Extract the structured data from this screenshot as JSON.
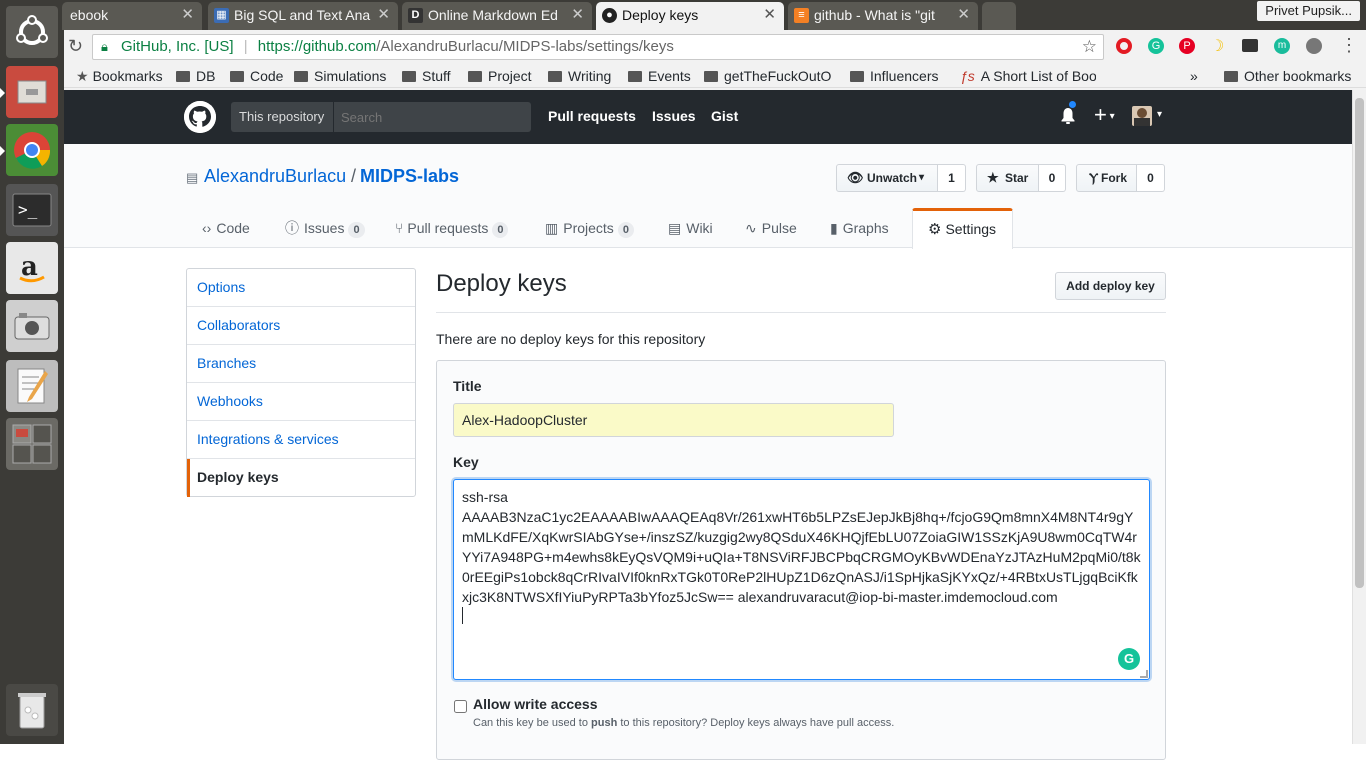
{
  "browser": {
    "tabs": [
      {
        "title": "ebook",
        "favicon": "facebook-icon"
      },
      {
        "title": "Big SQL and Text Ana",
        "favicon": "chart-icon"
      },
      {
        "title": "Online Markdown Ed",
        "favicon": "d-icon"
      },
      {
        "title": "Deploy keys",
        "favicon": "github-icon",
        "active": true
      },
      {
        "title": "github - What is \"git",
        "favicon": "stackoverflow-icon"
      }
    ],
    "profile_name": "Privet Pupsik...",
    "url_security_label": "GitHub, Inc. [US]",
    "url_domain": "https://github.com",
    "url_path": "/AlexandruBurlacu/MIDPS-labs/settings/keys",
    "bookmarks": [
      "Bookmarks",
      "DB",
      "Code",
      "Simulations",
      "Stuff",
      "Project",
      "Writing",
      "Events",
      "getTheFuckOutO",
      "Influencers",
      "A Short List of Boo"
    ],
    "overflow": "»",
    "other_bookmarks": "Other bookmarks"
  },
  "github_header": {
    "scope_label": "This repository",
    "search_placeholder": "Search",
    "nav": [
      "Pull requests",
      "Issues",
      "Gist"
    ],
    "plus_icon": "+"
  },
  "repo": {
    "owner": "AlexandruBurlacu",
    "separator": "/",
    "name": "MIDPS-labs",
    "unwatch_label": "Unwatch",
    "watch_count": "1",
    "star_label": "Star",
    "star_count": "0",
    "fork_label": "Fork",
    "fork_count": "0",
    "tabs": [
      {
        "label": "Code",
        "icon": "code-icon"
      },
      {
        "label": "Issues",
        "count": "0",
        "icon": "issue-icon"
      },
      {
        "label": "Pull requests",
        "count": "0",
        "icon": "pr-icon"
      },
      {
        "label": "Projects",
        "count": "0",
        "icon": "project-icon"
      },
      {
        "label": "Wiki",
        "icon": "book-icon"
      },
      {
        "label": "Pulse",
        "icon": "pulse-icon"
      },
      {
        "label": "Graphs",
        "icon": "graph-icon"
      },
      {
        "label": "Settings",
        "icon": "gear-icon",
        "active": true
      }
    ]
  },
  "settings_menu": [
    "Options",
    "Collaborators",
    "Branches",
    "Webhooks",
    "Integrations & services",
    "Deploy keys"
  ],
  "deploy_keys": {
    "heading": "Deploy keys",
    "add_button": "Add deploy key",
    "empty_message": "There are no deploy keys for this repository",
    "title_label": "Title",
    "title_value": "Alex-HadoopCluster",
    "key_label": "Key",
    "key_value": "ssh-rsa\nAAAAB3NzaC1yc2EAAAABIwAAAQEAq8Vr/261xwHT6b5LPZsEJepJkBj8hq+/fcjoG9Qm8mnX4M8NT4r9gYmMLKdFE/XqKwrSIAbGYse+/inszSZ/kuzgig2wy8QSduX46KHQjfEbLU07ZoiaGIW1SSzKjA9U8wm0CqTW4rYYi7A948PG+m4ewhs8kEyQsVQM9i+uQIa+T8NSViRFJBCPbqCRGMOyKBvWDEnaYzJTAzHuM2pqMi0/t8k0rEEgiPs1obck8qCrRIvaIVIf0knRxTGk0T0ReP2lHUpZ1D6zQnASJ/i1SpHjkaSjKYxQz/+4RBtxUsTLjgqBciKfkxjc3K8NTWSXfIYiuPyRPTa3bYfoz5JcSw== alexandruvaracut@iop-bi-master.imdemocloud.com",
    "write_access_label": "Allow write access",
    "write_access_help_pre": "Can this key be used to",
    "write_access_help_bold": "push",
    "write_access_help_post": "to this repository? Deploy keys always have pull access."
  },
  "colors": {
    "launcher_bg": "#3c3b37",
    "gh_header": "#24292e",
    "link": "#0366d6",
    "settings_accent": "#e36209",
    "title_field_bg": "#fafac8",
    "key_border": "#2188ff",
    "grammarly": "#15c39a"
  },
  "launcher_icons": [
    "ubuntu-dash-icon",
    "files-icon",
    "chrome-icon",
    "terminal-icon",
    "amazon-icon",
    "camera-icon",
    "text-editor-icon",
    "workspace-switcher-icon",
    "trash-icon"
  ]
}
